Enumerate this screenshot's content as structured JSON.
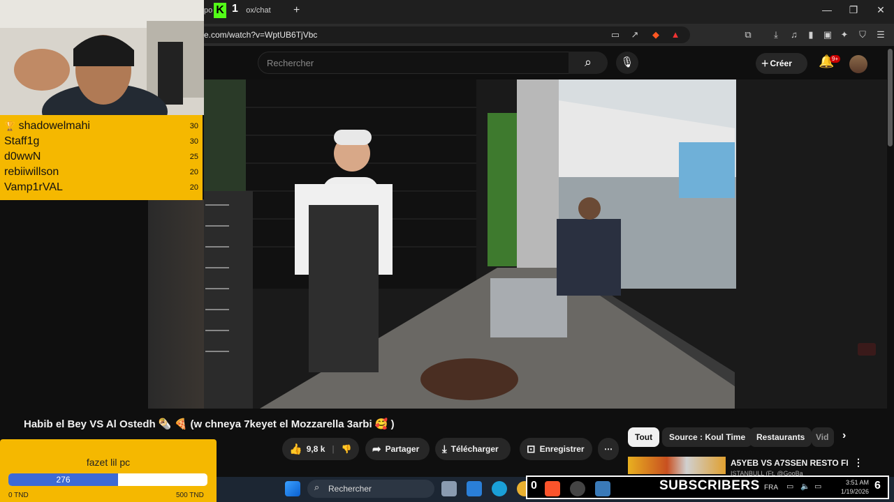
{
  "browser": {
    "tab_title": "po",
    "tab_title_tail": "ox/chat",
    "kick_logo": "K",
    "kick_count": "1",
    "new_tab": "+",
    "url": "e.com/watch?v=WptUB6TjVbc"
  },
  "youtube": {
    "search_placeholder": "Rechercher",
    "create_label": "Créer",
    "notifications_badge": "9+"
  },
  "video": {
    "title": "Habib el Bey VS Al Ostedh 🌯 🍕 (w chneya 7keyet el Mozzarella 3arbi 🥰 )",
    "likes": "9,8 k",
    "share_label": "Partager",
    "download_label": "Télécharger",
    "save_label": "Enregistrer",
    "more_label": "⋯"
  },
  "chips": [
    {
      "label": "Tout",
      "active": true
    },
    {
      "label": "Source : Koul Time",
      "active": false
    },
    {
      "label": "Restaurants",
      "active": false
    },
    {
      "label": "Vid",
      "active": false
    }
  ],
  "recommended": {
    "title": "A5YEB VS A7SSEN RESTO FI",
    "subtitle": "ISTANBULL (Ft. @GooBa"
  },
  "leaderboard": [
    {
      "name": "shadowelmahi",
      "score": "30",
      "trophy": true
    },
    {
      "name": "Staff1g",
      "score": "30"
    },
    {
      "name": "d0wwN",
      "score": "25"
    },
    {
      "name": "rebiiwillson",
      "score": "20"
    },
    {
      "name": "Vamp1rVAL",
      "score": "20"
    }
  ],
  "goal": {
    "title": "fazet lil pc",
    "current": "276",
    "progress": 0.55,
    "min_label": "0 TND",
    "max_label": "500 TND"
  },
  "taskbar": {
    "search_label": "Rechercher",
    "language": "FRA",
    "time": "3:51 AM",
    "date": "1/19/2026"
  },
  "subs_overlay": {
    "count_left": "0",
    "label": "SUBSCRIBERS",
    "count_right": "6"
  },
  "colors": {
    "kick_green": "#53fc18",
    "overlay_yellow": "#f5b800",
    "goal_blue": "#3d6ad6",
    "yt_red": "#cc0000"
  }
}
